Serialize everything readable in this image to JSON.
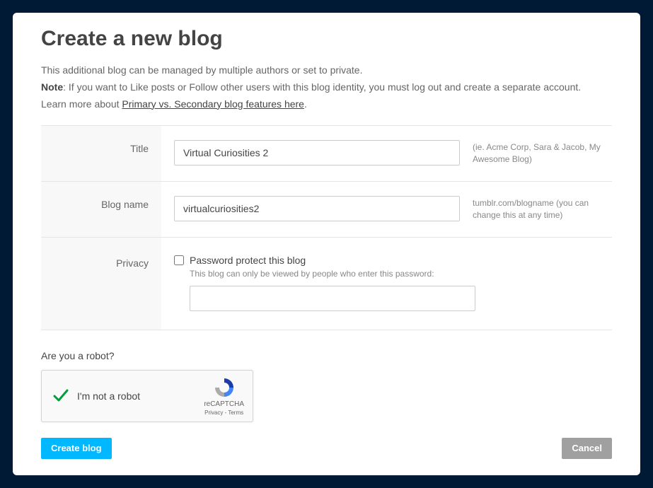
{
  "heading": "Create a new blog",
  "intro": {
    "line1": "This additional blog can be managed by multiple authors or set to private.",
    "note_label": "Note",
    "note_text": ": If you want to Like posts or Follow other users with this blog identity, you must log out and create a separate account.",
    "learn_prefix": "Learn more about ",
    "learn_link": "Primary vs. Secondary blog features here",
    "learn_suffix": "."
  },
  "fields": {
    "title": {
      "label": "Title",
      "value": "Virtual Curiosities 2",
      "hint": "(ie. Acme Corp, Sara & Jacob, My Awesome Blog)"
    },
    "blogname": {
      "label": "Blog name",
      "value": "virtualcuriosities2",
      "hint": "tumblr.com/blogname (you can change this at any time)"
    },
    "privacy": {
      "label": "Privacy",
      "checkbox_label": "Password protect this blog",
      "description": "This blog can only be viewed by people who enter this password:"
    }
  },
  "robot": {
    "question": "Are you a robot?",
    "label": "I'm not a robot",
    "brand": "reCAPTCHA",
    "privacy": "Privacy",
    "terms": "Terms"
  },
  "actions": {
    "create": "Create blog",
    "cancel": "Cancel"
  }
}
